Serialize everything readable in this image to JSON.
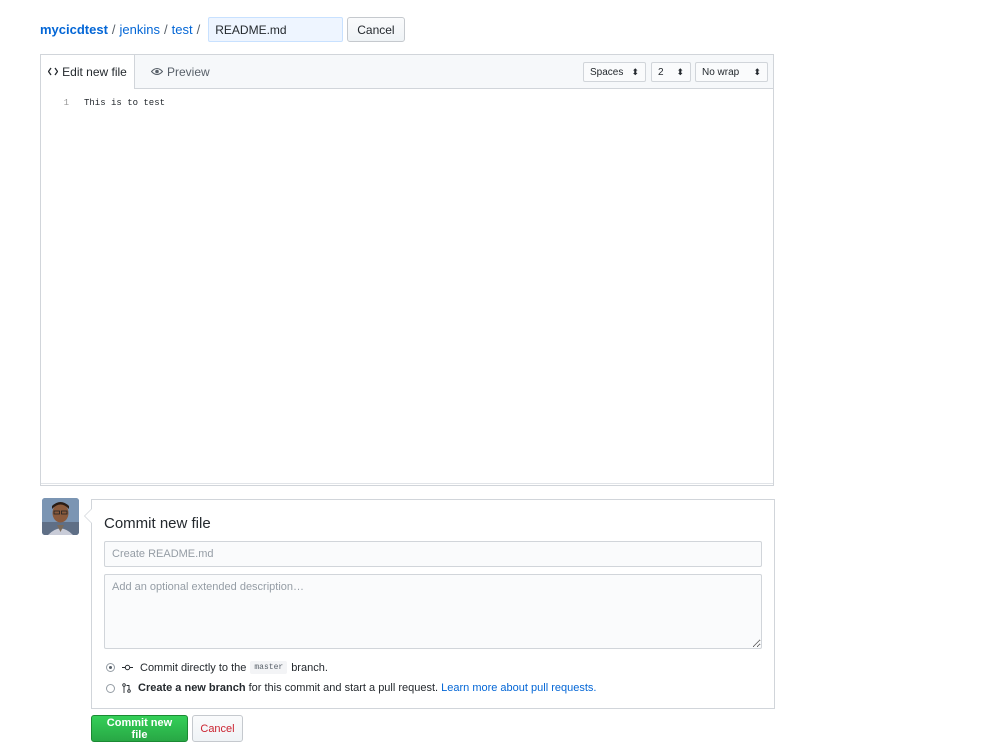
{
  "breadcrumb": {
    "owner": "mycicdtest",
    "parts": [
      "jenkins",
      "test"
    ],
    "separator": "/",
    "filename_value": "README.md",
    "cancel_label": "Cancel"
  },
  "editor": {
    "tabs": [
      {
        "label": "Edit new file",
        "icon": "code-icon",
        "active": true
      },
      {
        "label": "Preview",
        "icon": "eye-icon",
        "active": false
      }
    ],
    "indent_mode": "Spaces",
    "indent_size": "2",
    "wrap_mode": "No wrap",
    "lines": [
      {
        "number": "1",
        "text": "This is to test"
      }
    ]
  },
  "commit": {
    "title": "Commit new file",
    "summary_placeholder": "Create README.md",
    "description_placeholder": "Add an optional extended description…",
    "options": [
      {
        "checked": true,
        "icon": "git-commit-icon",
        "prefix": "Commit directly to the",
        "branch": "master",
        "suffix": "branch."
      },
      {
        "checked": false,
        "icon": "git-pull-request-icon",
        "bold_text": "Create a new branch",
        "text": "for this commit and start a pull request.",
        "link": "Learn more about pull requests."
      }
    ],
    "submit_label": "Commit new file",
    "cancel_label": "Cancel"
  },
  "colors": {
    "link": "#0366d6",
    "primary_button": "#28a745",
    "danger_text": "#cb2431"
  }
}
